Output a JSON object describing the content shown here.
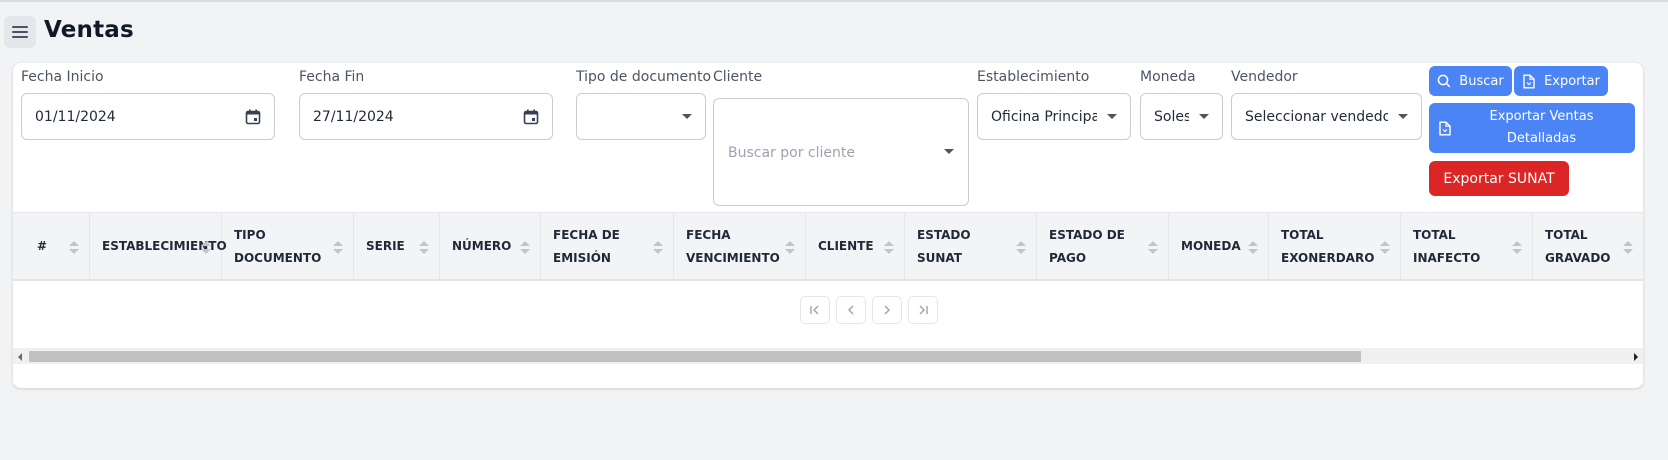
{
  "header": {
    "title": "Ventas",
    "menu_icon": "hamburger-menu-icon"
  },
  "filters": {
    "fecha_inicio": {
      "label": "Fecha Inicio",
      "value": "01/11/2024"
    },
    "fecha_fin": {
      "label": "Fecha Fin",
      "value": "27/11/2024"
    },
    "tipo_documento": {
      "label": "Tipo de documento",
      "value": ""
    },
    "cliente": {
      "label": "Cliente",
      "placeholder": "Buscar por cliente"
    },
    "establecimiento": {
      "label": "Establecimiento",
      "value": "Oficina Principal"
    },
    "moneda": {
      "label": "Moneda",
      "value": "Soles"
    },
    "vendedor": {
      "label": "Vendedor",
      "value": "Seleccionar vendedor"
    }
  },
  "actions": {
    "buscar": "Buscar",
    "exportar": "Exportar",
    "exportar_detalladas_line1": "Exportar Ventas",
    "exportar_detalladas_line2": "Detalladas",
    "exportar_sunat": "Exportar SUNAT"
  },
  "table": {
    "columns": [
      {
        "line1": "#",
        "line2": ""
      },
      {
        "line1": "ESTABLECIMIENTO",
        "line2": ""
      },
      {
        "line1": "TIPO",
        "line2": "DOCUMENTO"
      },
      {
        "line1": "SERIE",
        "line2": ""
      },
      {
        "line1": "NÚMERO",
        "line2": ""
      },
      {
        "line1": "FECHA DE",
        "line2": "EMISIÓN"
      },
      {
        "line1": "FECHA",
        "line2": "VENCIMIENTO"
      },
      {
        "line1": "CLIENTE",
        "line2": ""
      },
      {
        "line1": "ESTADO",
        "line2": "SUNAT"
      },
      {
        "line1": "ESTADO DE",
        "line2": "PAGO"
      },
      {
        "line1": "MONEDA",
        "line2": ""
      },
      {
        "line1": "TOTAL",
        "line2": "EXONERDARO"
      },
      {
        "line1": "TOTAL",
        "line2": "INAFECTO"
      },
      {
        "line1": "TOTAL",
        "line2": "GRAVADO"
      }
    ],
    "rows": []
  },
  "colors": {
    "primary": "#4a84f5",
    "danger": "#dc2626",
    "background": "#f2f3f5"
  }
}
